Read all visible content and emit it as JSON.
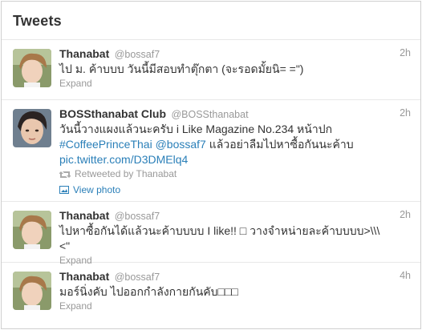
{
  "header": {
    "title": "Tweets"
  },
  "tweets": [
    {
      "fullname": "Thanabat",
      "username": "@bossaf7",
      "time": "2h",
      "text": "ไป ม. ค้าบบบ วันนี้มีสอบทำตุ๊กตา (จะรอดมั้ยนิ= =\")",
      "expand": "Expand"
    },
    {
      "fullname": "BOSSthanabat Club",
      "username": "@BOSSthanabat",
      "time": "2h",
      "text_part1": "วันนี้วางแผงแล้วนะครับ i Like Magazine No.234 หน้าปก",
      "hashtag": "#CoffeePrinceThai",
      "mention": "@bossaf7",
      "text_part2": "แล้วอย่าลืมไปหาซื้อกันนะค้าบ",
      "media_link": "pic.twitter.com/D3DMElq4",
      "retweeted_by": "Retweeted by Thanabat",
      "view_photo": "View photo"
    },
    {
      "fullname": "Thanabat",
      "username": "@bossaf7",
      "time": "2h",
      "text": "ไปหาซื้อกันได้แล้วนะค้าบบบบ I like!! □ วางจำหน่ายละค้าบบบบ>\\\\\\<\"",
      "expand": "Expand"
    },
    {
      "fullname": "Thanabat",
      "username": "@bossaf7",
      "time": "4h",
      "text": "มอร์นิ่งคับ ไปออกกำลังกายกันคับ□□□",
      "expand": "Expand"
    }
  ],
  "colors": {
    "link": "#2a7fb8",
    "muted": "#999999",
    "text": "#333333",
    "border": "#e8e8e8"
  }
}
